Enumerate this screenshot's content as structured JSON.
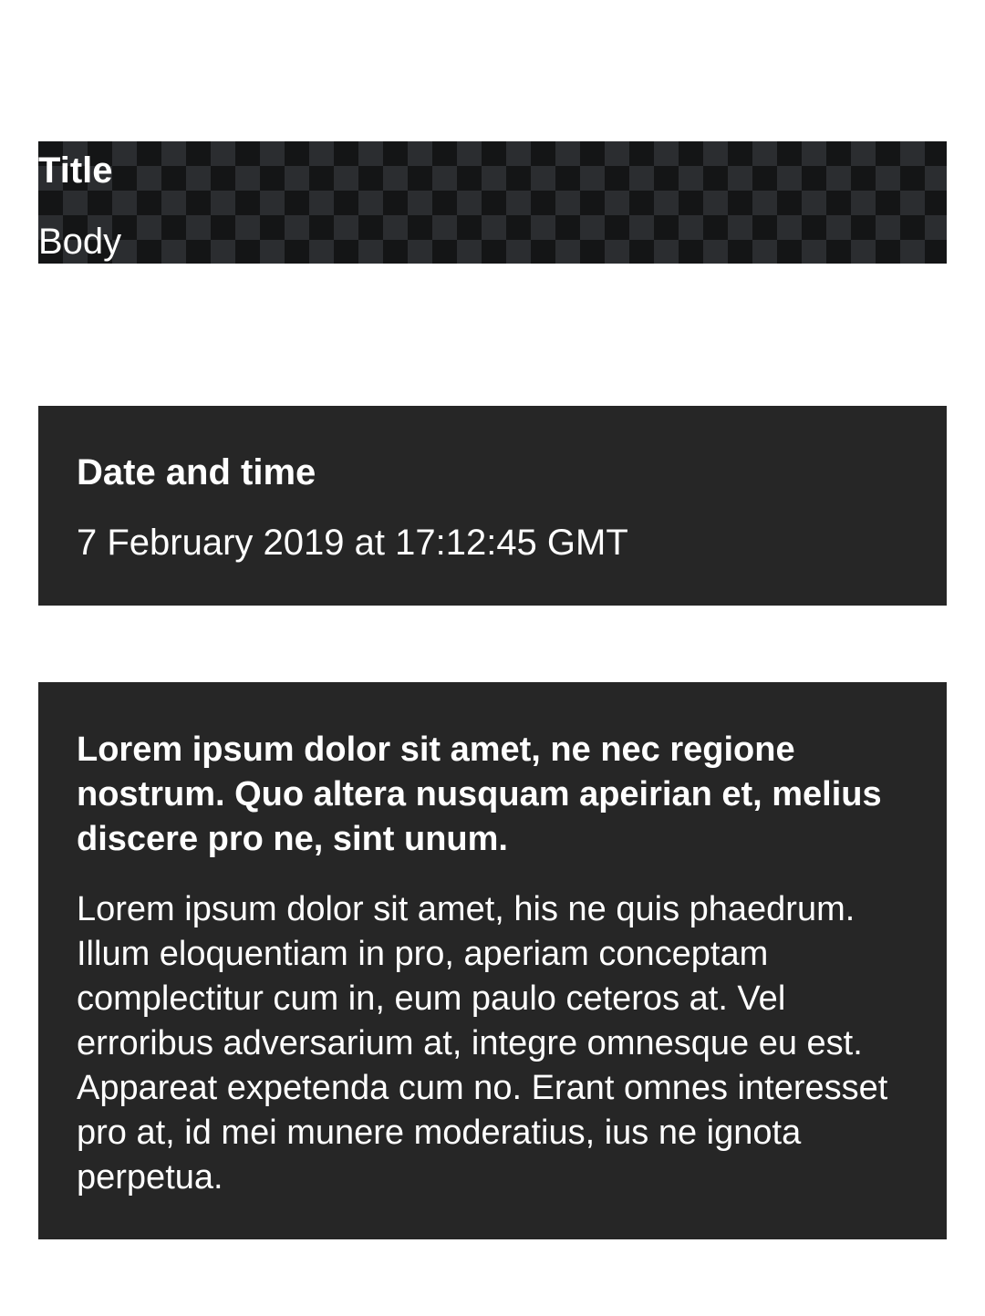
{
  "checker_card": {
    "title": "Title",
    "body": "Body"
  },
  "date_card": {
    "title": "Date and time",
    "value": "7 February 2019 at 17:12:45 GMT"
  },
  "lorem_card": {
    "title": "Lorem ipsum dolor sit amet, ne nec regione nostrum. Quo altera nusquam apeirian et, melius discere pro ne, sint unum.",
    "text": "Lorem ipsum dolor sit amet, his ne quis phaedrum. Illum eloquentiam in pro, aperiam conceptam complectitur cum in, eum paulo ceteros at. Vel erroribus adversarium at, integre omnesque eu est. Appareat expetenda cum no. Erant omnes interesset pro at, id mei munere moderatius, ius ne ignota perpetua."
  },
  "colors": {
    "page_background": "#ffffff",
    "card_background": "#262626",
    "text": "#ffffff"
  }
}
